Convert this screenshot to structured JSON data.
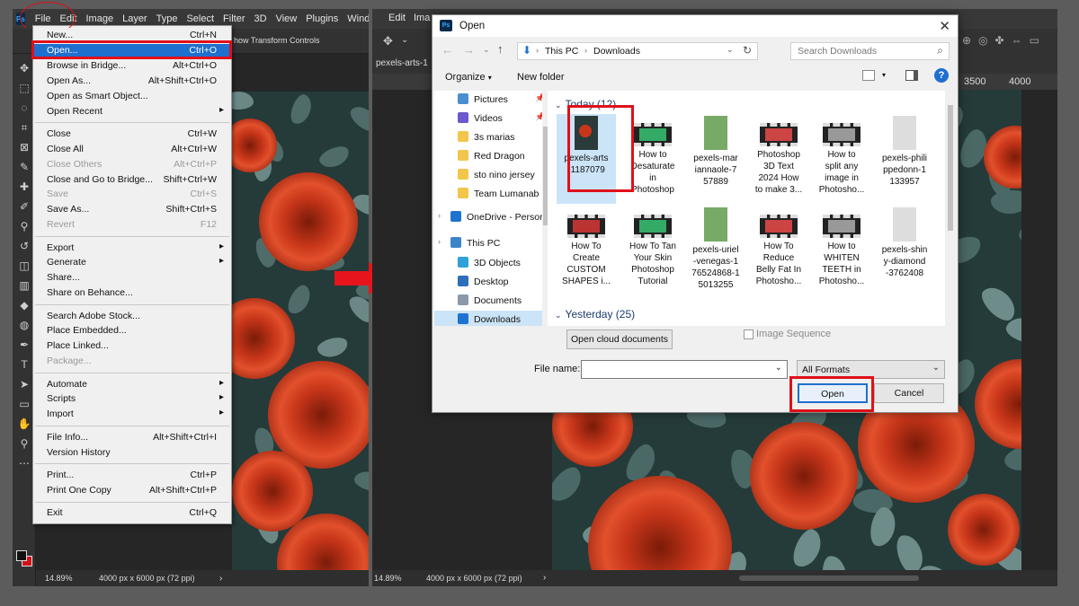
{
  "left_app": {
    "menu": [
      "File",
      "Edit",
      "Image",
      "Layer",
      "Type",
      "Select",
      "Filter",
      "3D",
      "View",
      "Plugins",
      "Window"
    ],
    "options_text": "how Transform Controls",
    "status": {
      "zoom": "14.89%",
      "doc": "4000 px x 6000 px (72 ppi)"
    }
  },
  "file_menu": {
    "items": [
      {
        "label": "New...",
        "shortcut": "Ctrl+N"
      },
      {
        "label": "Open...",
        "shortcut": "Ctrl+O",
        "highlighted": true
      },
      {
        "label": "Browse in Bridge...",
        "shortcut": "Alt+Ctrl+O"
      },
      {
        "label": "Open As...",
        "shortcut": "Alt+Shift+Ctrl+O"
      },
      {
        "label": "Open as Smart Object...",
        "shortcut": ""
      },
      {
        "label": "Open Recent",
        "shortcut": "",
        "submenu": true
      },
      {
        "label": "Close",
        "shortcut": "Ctrl+W"
      },
      {
        "label": "Close All",
        "shortcut": "Alt+Ctrl+W"
      },
      {
        "label": "Close Others",
        "shortcut": "Alt+Ctrl+P",
        "disabled": true
      },
      {
        "label": "Close and Go to Bridge...",
        "shortcut": "Shift+Ctrl+W"
      },
      {
        "label": "Save",
        "shortcut": "Ctrl+S",
        "disabled": true
      },
      {
        "label": "Save As...",
        "shortcut": "Shift+Ctrl+S"
      },
      {
        "label": "Revert",
        "shortcut": "F12",
        "disabled": true
      },
      {
        "label": "Export",
        "shortcut": "",
        "submenu": true
      },
      {
        "label": "Generate",
        "shortcut": "",
        "submenu": true
      },
      {
        "label": "Share...",
        "shortcut": ""
      },
      {
        "label": "Share on Behance...",
        "shortcut": ""
      },
      {
        "label": "Search Adobe Stock...",
        "shortcut": ""
      },
      {
        "label": "Place Embedded...",
        "shortcut": ""
      },
      {
        "label": "Place Linked...",
        "shortcut": ""
      },
      {
        "label": "Package...",
        "shortcut": "",
        "disabled": true
      },
      {
        "label": "Automate",
        "shortcut": "",
        "submenu": true
      },
      {
        "label": "Scripts",
        "shortcut": "",
        "submenu": true
      },
      {
        "label": "Import",
        "shortcut": "",
        "submenu": true
      },
      {
        "label": "File Info...",
        "shortcut": "Alt+Shift+Ctrl+I"
      },
      {
        "label": "Version History",
        "shortcut": ""
      },
      {
        "label": "Print...",
        "shortcut": "Ctrl+P"
      },
      {
        "label": "Print One Copy",
        "shortcut": "Alt+Shift+Ctrl+P"
      },
      {
        "label": "Exit",
        "shortcut": "Ctrl+Q"
      }
    ]
  },
  "right_app": {
    "menu": [
      "Edit",
      "Ima"
    ],
    "tab": "pexels-arts-1",
    "ruler": [
      "3500",
      "4000"
    ],
    "status": {
      "zoom": "14.89%",
      "doc": "4000 px x 6000 px (72 ppi)"
    }
  },
  "dialog": {
    "title": "Open",
    "path": [
      "This PC",
      "Downloads"
    ],
    "search_placeholder": "Search Downloads",
    "organize": "Organize",
    "new_folder": "New folder",
    "nav": [
      {
        "label": "Pictures",
        "icon": "pictures-icon",
        "pinned": true
      },
      {
        "label": "Videos",
        "icon": "videos-icon",
        "pinned": true
      },
      {
        "label": "3s marias",
        "icon": "folder-icon"
      },
      {
        "label": "Red Dragon",
        "icon": "folder-icon"
      },
      {
        "label": "sto nino jersey",
        "icon": "folder-icon"
      },
      {
        "label": "Team Lumanab",
        "icon": "folder-icon"
      },
      {
        "label": "OneDrive - Persor",
        "icon": "onedrive-icon"
      },
      {
        "label": "This PC",
        "icon": "computer-icon"
      },
      {
        "label": "3D Objects",
        "icon": "3d-objects-icon"
      },
      {
        "label": "Desktop",
        "icon": "desktop-icon"
      },
      {
        "label": "Documents",
        "icon": "documents-icon"
      },
      {
        "label": "Downloads",
        "icon": "downloads-icon",
        "selected": true
      }
    ],
    "groups": {
      "today": "Today (12)",
      "yesterday": "Yesterday (25)"
    },
    "files": [
      {
        "name": "pexels-arts\n-1187079",
        "kind": "image",
        "selected": true
      },
      {
        "name": "How to\nDesaturate\nin\nPhotoshop",
        "kind": "video"
      },
      {
        "name": "pexels-mar\niannaole-7\n57889",
        "kind": "image"
      },
      {
        "name": "Photoshop\n3D Text\n2024  How\nto make 3...",
        "kind": "video"
      },
      {
        "name": "How to\nsplit any\nimage in\nPhotosho...",
        "kind": "video"
      },
      {
        "name": "pexels-phili\nppedonn-1\n133957",
        "kind": "image"
      },
      {
        "name": "How To\nCreate\nCUSTOM\nSHAPES i...",
        "kind": "video"
      },
      {
        "name": "How To Tan\nYour Skin\nPhotoshop\nTutorial",
        "kind": "video"
      },
      {
        "name": "pexels-uriel\n-venegas-1\n76524868-1\n5013255",
        "kind": "image"
      },
      {
        "name": "How To\nReduce\nBelly Fat In\nPhotosho...",
        "kind": "video"
      },
      {
        "name": "How to\nWHITEN\nTEETH in\nPhotosho...",
        "kind": "video"
      },
      {
        "name": "pexels-shin\ny-diamond\n-3762408",
        "kind": "image"
      }
    ],
    "cloud_button": "Open cloud documents",
    "image_sequence": "Image Sequence",
    "filename_label": "File name:",
    "filename_value": "",
    "format": "All Formats",
    "open_button": "Open",
    "cancel_button": "Cancel"
  }
}
